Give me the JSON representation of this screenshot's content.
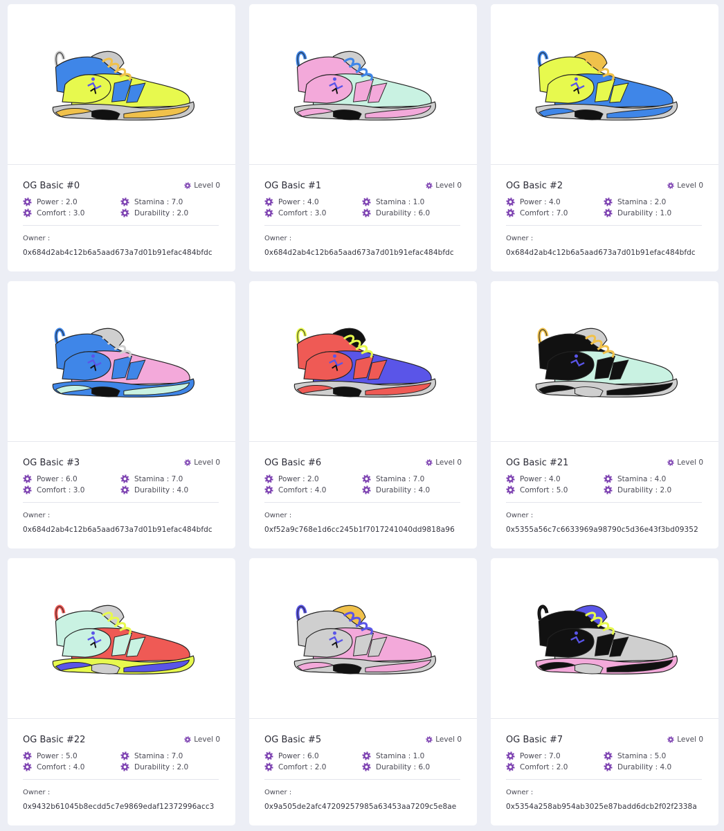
{
  "cards": [
    {
      "title": "OG Basic #0",
      "level": "Level 0",
      "power": "Power : 2.0",
      "stamina": "Stamina : 7.0",
      "comfort": "Comfort : 3.0",
      "durability": "Durability : 2.0",
      "owner_label": "Owner :",
      "owner": "0x684d2ab4c12b6a5aad673a7d01b91efac484bfdc",
      "colors": {
        "upper": "#e7f94e",
        "collar": "#3f86e8",
        "stripe": "#e7f94e",
        "sole": "#f0c14b",
        "midsole": "#c9c9c9",
        "outsole": "#111111",
        "lace": "#f0c14b",
        "loop": "#c9c9c9",
        "tongue": "#c9c9c9"
      }
    },
    {
      "title": "OG Basic #1",
      "level": "Level 0",
      "power": "Power : 4.0",
      "stamina": "Stamina : 1.0",
      "comfort": "Comfort : 3.0",
      "durability": "Durability : 6.0",
      "owner_label": "Owner :",
      "owner": "0x684d2ab4c12b6a5aad673a7d01b91efac484bfdc",
      "colors": {
        "upper": "#c9f2e2",
        "collar": "#f3a9da",
        "stripe": "#f3a9da",
        "sole": "#f3a9da",
        "midsole": "#cfcfcf",
        "outsole": "#111111",
        "lace": "#3f86e8",
        "loop": "#3f86e8",
        "tongue": "#cfcfcf"
      }
    },
    {
      "title": "OG Basic #2",
      "level": "Level 0",
      "power": "Power : 4.0",
      "stamina": "Stamina : 2.0",
      "comfort": "Comfort : 7.0",
      "durability": "Durability : 1.0",
      "owner_label": "Owner :",
      "owner": "0x684d2ab4c12b6a5aad673a7d01b91efac484bfdc",
      "colors": {
        "upper": "#3f86e8",
        "collar": "#e7f94e",
        "stripe": "#e7f94e",
        "sole": "#3f86e8",
        "midsole": "#cfcfcf",
        "outsole": "#111111",
        "lace": "#f0c14b",
        "loop": "#3f86e8",
        "tongue": "#f0c14b"
      }
    },
    {
      "title": "OG Basic #3",
      "level": "Level 0",
      "power": "Power : 6.0",
      "stamina": "Stamina : 7.0",
      "comfort": "Comfort : 3.0",
      "durability": "Durability : 4.0",
      "owner_label": "Owner :",
      "owner": "0x684d2ab4c12b6a5aad673a7d01b91efac484bfdc",
      "colors": {
        "upper": "#f3a9da",
        "collar": "#3f86e8",
        "stripe": "#3f86e8",
        "sole": "#c9f2e2",
        "midsole": "#3f86e8",
        "outsole": "#111111",
        "lace": "#cfcfcf",
        "loop": "#3f86e8",
        "tongue": "#cfcfcf"
      }
    },
    {
      "title": "OG Basic #6",
      "level": "Level 0",
      "power": "Power : 2.0",
      "stamina": "Stamina : 7.0",
      "comfort": "Comfort : 4.0",
      "durability": "Durability : 4.0",
      "owner_label": "Owner :",
      "owner": "0xf52a9c768e1d6cc245b1f7017241040dd9818a96",
      "colors": {
        "upper": "#5a55e8",
        "collar": "#ef5a55",
        "stripe": "#ef5a55",
        "sole": "#ef5a55",
        "midsole": "#cfcfcf",
        "outsole": "#111111",
        "lace": "#e7f94e",
        "loop": "#e7f94e",
        "tongue": "#111111"
      }
    },
    {
      "title": "OG Basic #21",
      "level": "Level 0",
      "power": "Power : 4.0",
      "stamina": "Stamina : 4.0",
      "comfort": "Comfort : 5.0",
      "durability": "Durability : 2.0",
      "owner_label": "Owner :",
      "owner": "0x5355a56c7c6633969a98790c5d36e43f3bd09352",
      "colors": {
        "upper": "#c9f2e2",
        "collar": "#111111",
        "stripe": "#111111",
        "sole": "#111111",
        "midsole": "#cfcfcf",
        "outsole": "#cfcfcf",
        "lace": "#f0c14b",
        "loop": "#f0c14b",
        "tongue": "#cfcfcf"
      }
    },
    {
      "title": "OG Basic #22",
      "level": "Level 0",
      "power": "Power : 5.0",
      "stamina": "Stamina : 7.0",
      "comfort": "Comfort : 4.0",
      "durability": "Durability : 2.0",
      "owner_label": "Owner :",
      "owner": "0x9432b61045b8ecdd5c7e9869edaf12372996acc3",
      "colors": {
        "upper": "#ef5a55",
        "collar": "#c9f2e2",
        "stripe": "#c9f2e2",
        "sole": "#5a55e8",
        "midsole": "#e7f94e",
        "outsole": "#cfcfcf",
        "lace": "#e7f94e",
        "loop": "#ef5a55",
        "tongue": "#cfcfcf"
      }
    },
    {
      "title": "OG Basic #5",
      "level": "Level 0",
      "power": "Power : 6.0",
      "stamina": "Stamina : 1.0",
      "comfort": "Comfort : 2.0",
      "durability": "Durability : 6.0",
      "owner_label": "Owner :",
      "owner": "0x9a505de2afc47209257985a63453aa7209c5e8ae",
      "colors": {
        "upper": "#f3a9da",
        "collar": "#cfcfcf",
        "stripe": "#cfcfcf",
        "sole": "#f3a9da",
        "midsole": "#cfcfcf",
        "outsole": "#111111",
        "lace": "#5a55e8",
        "loop": "#5a55e8",
        "tongue": "#f0c14b"
      }
    },
    {
      "title": "OG Basic #7",
      "level": "Level 0",
      "power": "Power : 7.0",
      "stamina": "Stamina : 5.0",
      "comfort": "Comfort : 2.0",
      "durability": "Durability : 4.0",
      "owner_label": "Owner :",
      "owner": "0x5354a258ab954ab3025e87badd6dcb2f02f2338a",
      "colors": {
        "upper": "#cfcfcf",
        "collar": "#111111",
        "stripe": "#111111",
        "sole": "#111111",
        "midsole": "#f3a9da",
        "outsole": "#cfcfcf",
        "lace": "#e7f94e",
        "loop": "#111111",
        "tongue": "#5a55e8"
      }
    }
  ],
  "accent_color": "#7b3fb0",
  "icon": "gear-icon",
  "image": "sneaker-illustration"
}
